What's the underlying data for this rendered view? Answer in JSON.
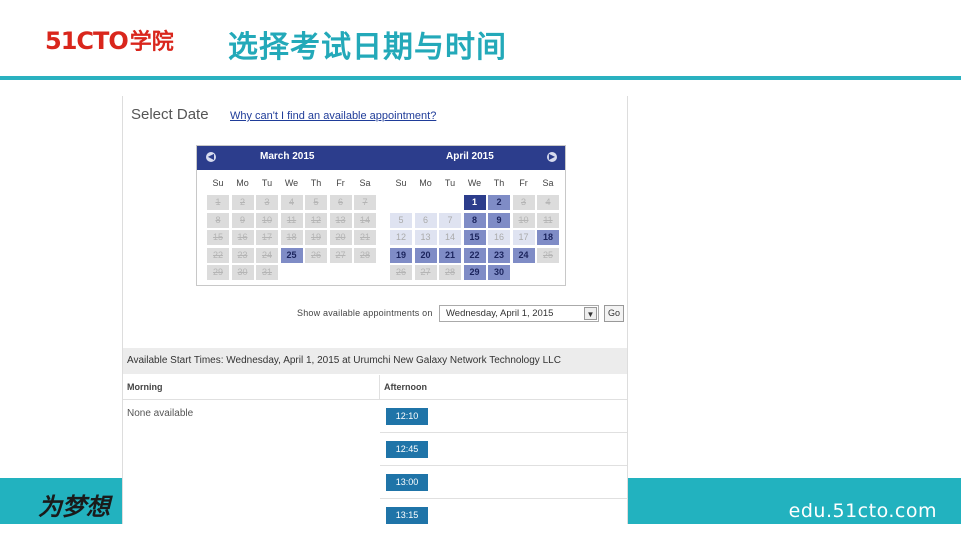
{
  "slide": {
    "logo_number": "51CTO",
    "logo_cn": "学院",
    "title": "选择考试日期与时间",
    "footer_slogan": "为梦想",
    "footer_url": "edu.51cto.com",
    "colors": {
      "teal": "#22b2bf",
      "brand_red": "#d9261c",
      "calendar_blue": "#2c3d8c",
      "slot_blue": "#1f74a8"
    }
  },
  "panel": {
    "heading": "Select Date",
    "help_link": "Why can't I find an available appointment?",
    "calendar": {
      "prev_icon": "chevron-left-icon",
      "next_icon": "chevron-right-icon",
      "months": [
        {
          "title": "March 2015",
          "dow": [
            "Su",
            "Mo",
            "Tu",
            "We",
            "Th",
            "Fr",
            "Sa"
          ],
          "weeks": [
            [
              {
                "d": "1",
                "s": "past"
              },
              {
                "d": "2",
                "s": "past"
              },
              {
                "d": "3",
                "s": "past"
              },
              {
                "d": "4",
                "s": "past"
              },
              {
                "d": "5",
                "s": "past"
              },
              {
                "d": "6",
                "s": "past"
              },
              {
                "d": "7",
                "s": "past"
              }
            ],
            [
              {
                "d": "8",
                "s": "past"
              },
              {
                "d": "9",
                "s": "past"
              },
              {
                "d": "10",
                "s": "past"
              },
              {
                "d": "11",
                "s": "past"
              },
              {
                "d": "12",
                "s": "past"
              },
              {
                "d": "13",
                "s": "past"
              },
              {
                "d": "14",
                "s": "past"
              }
            ],
            [
              {
                "d": "15",
                "s": "past"
              },
              {
                "d": "16",
                "s": "past"
              },
              {
                "d": "17",
                "s": "past"
              },
              {
                "d": "18",
                "s": "past"
              },
              {
                "d": "19",
                "s": "past"
              },
              {
                "d": "20",
                "s": "past"
              },
              {
                "d": "21",
                "s": "past"
              }
            ],
            [
              {
                "d": "22",
                "s": "past"
              },
              {
                "d": "23",
                "s": "past"
              },
              {
                "d": "24",
                "s": "past"
              },
              {
                "d": "25",
                "s": "avail"
              },
              {
                "d": "26",
                "s": "past"
              },
              {
                "d": "27",
                "s": "past"
              },
              {
                "d": "28",
                "s": "past"
              }
            ],
            [
              {
                "d": "29",
                "s": "past"
              },
              {
                "d": "30",
                "s": "past"
              },
              {
                "d": "31",
                "s": "past"
              },
              null,
              null,
              null,
              null
            ]
          ]
        },
        {
          "title": "April 2015",
          "dow": [
            "Su",
            "Mo",
            "Tu",
            "We",
            "Th",
            "Fr",
            "Sa"
          ],
          "weeks": [
            [
              null,
              null,
              null,
              {
                "d": "1",
                "s": "sel"
              },
              {
                "d": "2",
                "s": "avail"
              },
              {
                "d": "3",
                "s": "past"
              },
              {
                "d": "4",
                "s": "past"
              }
            ],
            [
              {
                "d": "5",
                "s": "na"
              },
              {
                "d": "6",
                "s": "na"
              },
              {
                "d": "7",
                "s": "na"
              },
              {
                "d": "8",
                "s": "avail"
              },
              {
                "d": "9",
                "s": "avail"
              },
              {
                "d": "10",
                "s": "past"
              },
              {
                "d": "11",
                "s": "past"
              }
            ],
            [
              {
                "d": "12",
                "s": "na"
              },
              {
                "d": "13",
                "s": "na"
              },
              {
                "d": "14",
                "s": "na"
              },
              {
                "d": "15",
                "s": "avail"
              },
              {
                "d": "16",
                "s": "na"
              },
              {
                "d": "17",
                "s": "na"
              },
              {
                "d": "18",
                "s": "avail"
              }
            ],
            [
              {
                "d": "19",
                "s": "avail"
              },
              {
                "d": "20",
                "s": "avail"
              },
              {
                "d": "21",
                "s": "avail"
              },
              {
                "d": "22",
                "s": "avail"
              },
              {
                "d": "23",
                "s": "avail"
              },
              {
                "d": "24",
                "s": "avail"
              },
              {
                "d": "25",
                "s": "past"
              }
            ],
            [
              {
                "d": "26",
                "s": "past"
              },
              {
                "d": "27",
                "s": "past"
              },
              {
                "d": "28",
                "s": "past"
              },
              {
                "d": "29",
                "s": "avail"
              },
              {
                "d": "30",
                "s": "avail"
              },
              null,
              null
            ]
          ]
        }
      ]
    },
    "show_label": "Show available appointments on",
    "selected_date": "Wednesday, April 1, 2015",
    "go_label": "Go",
    "avail_heading": "Available Start Times: Wednesday, April 1, 2015 at Urumchi New Galaxy Network Technology LLC",
    "morning_label": "Morning",
    "afternoon_label": "Afternoon",
    "morning_none": "None available",
    "afternoon_slots": [
      "12:10",
      "12:45",
      "13:00",
      "13:15"
    ]
  }
}
